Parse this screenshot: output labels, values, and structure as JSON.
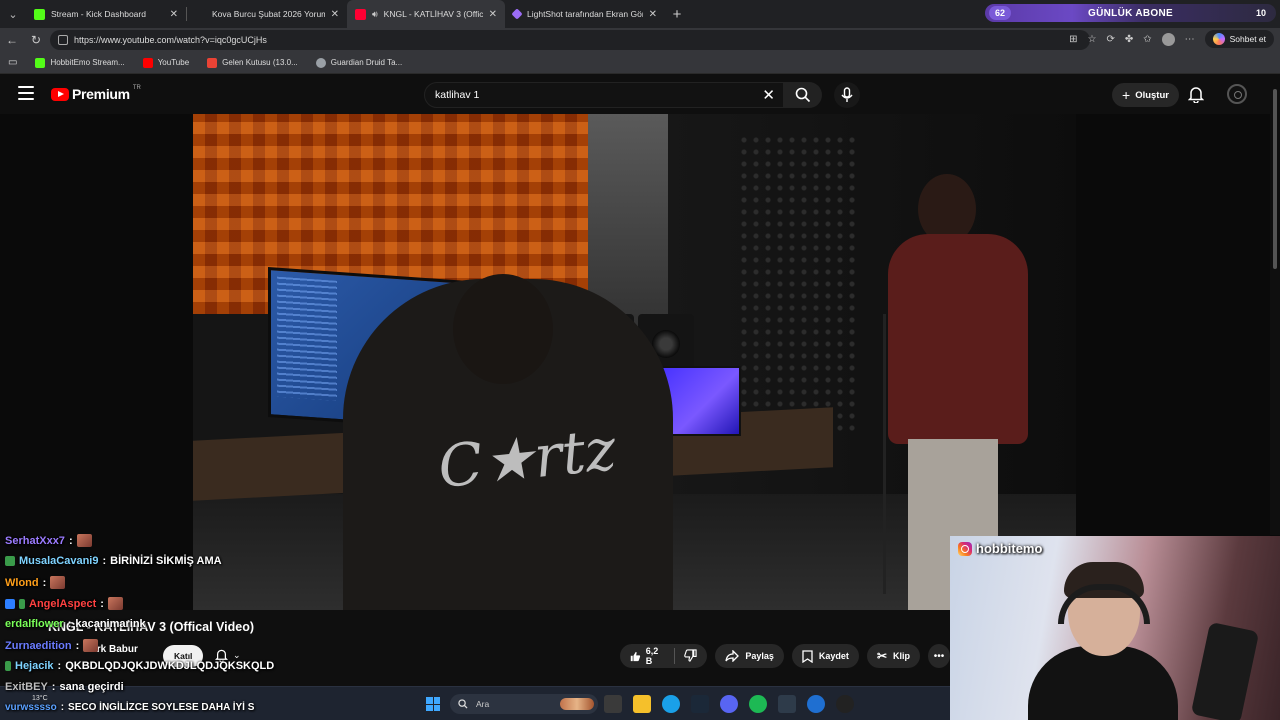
{
  "browser": {
    "tabs": [
      {
        "label": "Stream - Kick Dashboard",
        "favicon_color": "#53fc18",
        "active": false
      },
      {
        "label": "Kova Burcu Şubat 2026 Yorumu - G",
        "favicon_color": "#202124",
        "active": false
      },
      {
        "label": "KNGL - KATLİHAV 3 (Offical Vi",
        "favicon_color": "#ff0033",
        "active": true
      },
      {
        "label": "LightShot tarafından Ekran Görünt",
        "favicon_color": "#9b6cf5",
        "active": false
      }
    ],
    "url": "https://www.youtube.com/watch?v=iqc0gcUCjHs",
    "chat_button": "Sohbet et",
    "bookmarks": [
      {
        "label": "HobbitEmo Stream...",
        "icon_color": "#53fc18"
      },
      {
        "label": "YouTube",
        "icon_color": "#ff0000"
      },
      {
        "label": "Gelen Kutusu (13.0...",
        "icon_color": "#ea4335"
      },
      {
        "label": "Guardian Druid Ta...",
        "icon_color": "#9aa0a6"
      }
    ]
  },
  "widget": {
    "left_count": "62",
    "label": "GÜNLÜK ABONE",
    "right_count": "10"
  },
  "youtube": {
    "logo": "Premium",
    "region": "TR",
    "search_query": "katlihav 1",
    "create_label": "Oluştur",
    "video_title": "KNGL - KATLİHAV 3 (Offical Video)",
    "channel": "Berk Babur",
    "join_label": "Katıl",
    "like_count": "6,2 B",
    "share_label": "Paylaş",
    "save_label": "Kaydet",
    "clip_label": "Klip"
  },
  "taskbar": {
    "search_label": "Ara",
    "weather": "13°C"
  },
  "chat": [
    {
      "user": "SerhatXxx7",
      "color": "#9b7bff",
      "text": "",
      "emote": true,
      "badge": null
    },
    {
      "user": "MusalaCavani9",
      "color": "#7fd3ff",
      "text": "BİRİNİZİ SİKMİŞ AMA",
      "emote": false,
      "badge": "#3a9b4a"
    },
    {
      "user": "Wlond",
      "color": "#ff9f1a",
      "text": "",
      "emote": true,
      "badge": null
    },
    {
      "user": "AngelAspect",
      "color": "#ff4141",
      "text": "",
      "emote": true,
      "badge": "#2d7fff"
    },
    {
      "user": "erdalflower",
      "color": "#7aff59",
      "text": "kacanimarink",
      "emote": false,
      "badge": null
    },
    {
      "user": "Zurnaedition",
      "color": "#6b7cff",
      "text": "",
      "emote": true,
      "badge": null
    },
    {
      "user": "Hejacik",
      "color": "#7fd3ff",
      "text": "QKBDLQDJQKJDWKDJLQDJQKSKQLD",
      "emote": false,
      "badge": "#3a9b4a"
    },
    {
      "user": "ExitBEY",
      "color": "#bdbdbd",
      "text": "sana geçirdi",
      "emote": false,
      "badge": null
    },
    {
      "user": "vurwsssso",
      "color": "#5aa0ff",
      "text": "SECO İNGİLİZCE SOYLESE DAHA İYİ S",
      "emote": false,
      "badge": null
    }
  ],
  "webcam": {
    "username": "hobbitemo"
  }
}
